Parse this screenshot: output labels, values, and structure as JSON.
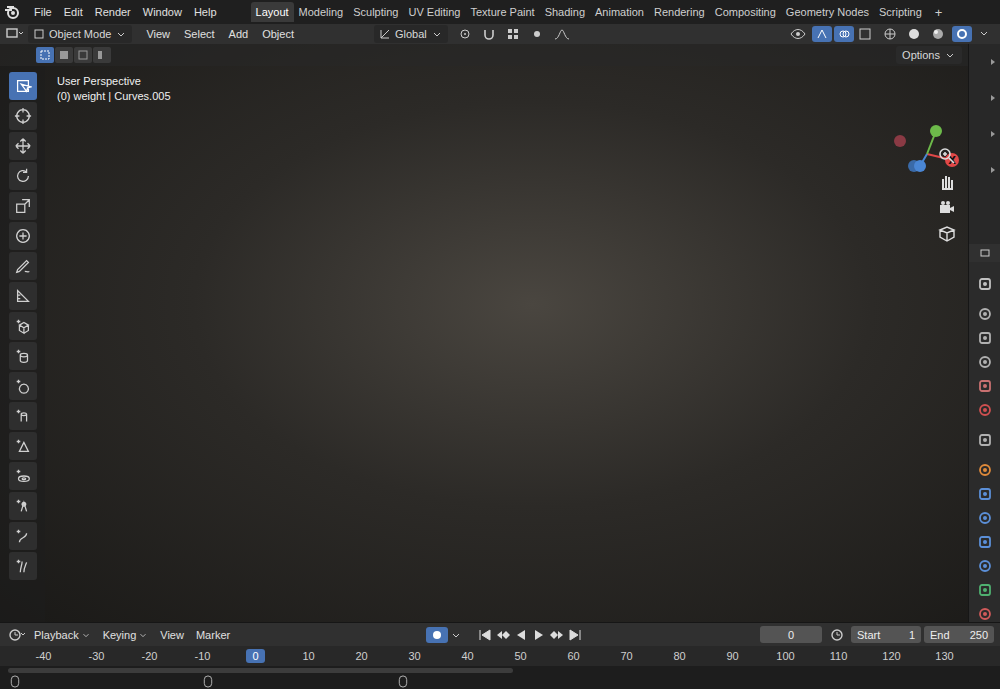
{
  "menu": [
    "File",
    "Edit",
    "Render",
    "Window",
    "Help"
  ],
  "workspaces": [
    {
      "label": "Layout",
      "selected": true
    },
    {
      "label": "Modeling",
      "selected": false
    },
    {
      "label": "Sculpting",
      "selected": false
    },
    {
      "label": "UV Editing",
      "selected": false
    },
    {
      "label": "Texture Paint",
      "selected": false
    },
    {
      "label": "Shading",
      "selected": false
    },
    {
      "label": "Animation",
      "selected": false
    },
    {
      "label": "Rendering",
      "selected": false
    },
    {
      "label": "Compositing",
      "selected": false
    },
    {
      "label": "Geometry Nodes",
      "selected": false
    },
    {
      "label": "Scripting",
      "selected": false
    }
  ],
  "add_workspace": "+",
  "header": {
    "mode": "Object Mode",
    "menus": [
      "View",
      "Select",
      "Add",
      "Object"
    ],
    "orientation": "Global",
    "options": "Options"
  },
  "viewport": {
    "perspective": "User Perspective",
    "object_info": "(0) weight | Curves.005",
    "gizmo_label": "X"
  },
  "tools": [
    {
      "selected": true
    },
    {
      "selected": false
    },
    {
      "selected": false
    },
    {
      "selected": false
    },
    {
      "selected": false
    },
    {
      "selected": false
    },
    {
      "selected": false
    },
    {
      "selected": false
    },
    {
      "selected": false
    },
    {
      "selected": false
    },
    {
      "selected": false
    },
    {
      "selected": false
    },
    {
      "selected": false
    },
    {
      "selected": false
    },
    {
      "selected": false
    },
    {
      "selected": false
    },
    {
      "selected": false
    }
  ],
  "timeline": {
    "menus": [
      "Playback",
      "Keying",
      "View",
      "Marker"
    ],
    "current_frame": "0",
    "start_label": "Start",
    "start": "1",
    "end_label": "End",
    "end": "250",
    "ticks": [
      {
        "label": "-40",
        "selected": false
      },
      {
        "label": "-30",
        "selected": false
      },
      {
        "label": "-20",
        "selected": false
      },
      {
        "label": "-10",
        "selected": false
      },
      {
        "label": "0",
        "selected": true
      },
      {
        "label": "10",
        "selected": false
      },
      {
        "label": "20",
        "selected": false
      },
      {
        "label": "30",
        "selected": false
      },
      {
        "label": "40",
        "selected": false
      },
      {
        "label": "50",
        "selected": false
      },
      {
        "label": "60",
        "selected": false
      },
      {
        "label": "70",
        "selected": false
      },
      {
        "label": "80",
        "selected": false
      },
      {
        "label": "90",
        "selected": false
      },
      {
        "label": "100",
        "selected": false
      },
      {
        "label": "110",
        "selected": false
      },
      {
        "label": "120",
        "selected": false
      },
      {
        "label": "130",
        "selected": false
      }
    ]
  }
}
